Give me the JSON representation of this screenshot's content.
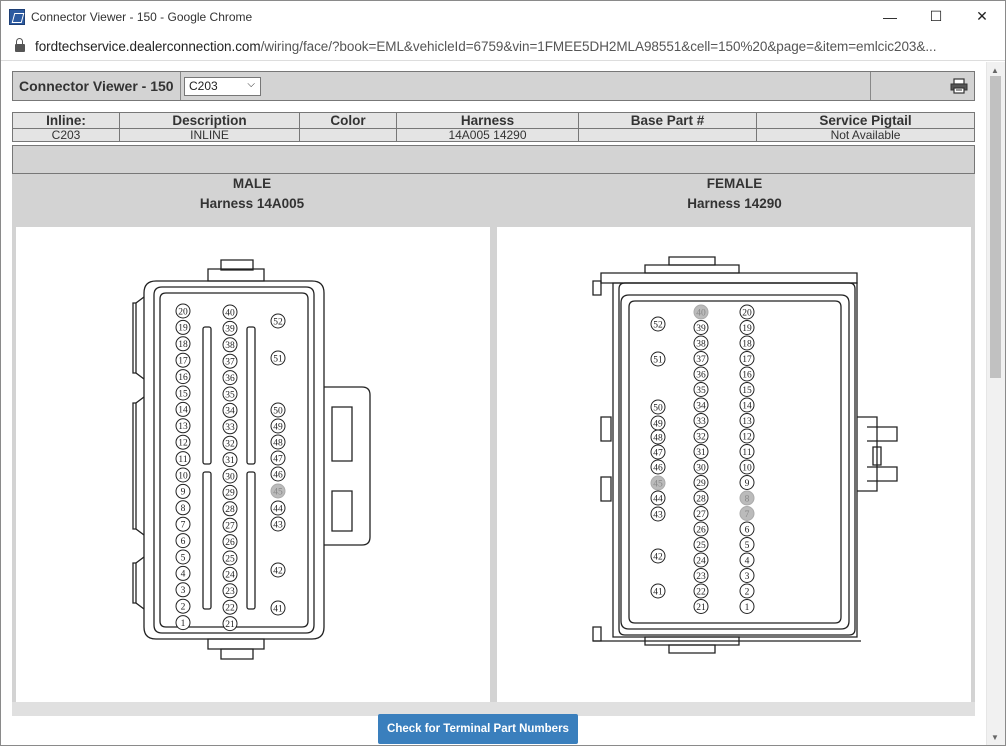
{
  "window": {
    "title": "Connector Viewer - 150 - Google Chrome",
    "minimize": "—",
    "maximize": "☐",
    "close": "✕"
  },
  "address": {
    "host": "fordtechservice.dealerconnection.com",
    "path": "/wiring/face/?book=EML&vehicleId=6759&vin=1FMEE5DH2MLA98551&cell=150%20&page=&item=emlcic203&..."
  },
  "viewer": {
    "title": "Connector Viewer - 150",
    "selected": "C203",
    "options": [
      "C203"
    ]
  },
  "table": {
    "headers": [
      "Inline:",
      "Description",
      "Color",
      "Harness",
      "Base Part #",
      "Service Pigtail"
    ],
    "row": [
      "C203",
      "INLINE",
      "",
      "14A005 14290",
      "",
      "Not Available"
    ]
  },
  "male": {
    "label": "MALE",
    "harness": "Harness 14A005",
    "dim_pins": [
      "45"
    ]
  },
  "female": {
    "label": "FEMALE",
    "harness": "Harness 14290",
    "dim_pins": [
      "40",
      "45",
      "8",
      "7"
    ]
  },
  "button": {
    "label": "Check for Terminal Part Numbers"
  }
}
